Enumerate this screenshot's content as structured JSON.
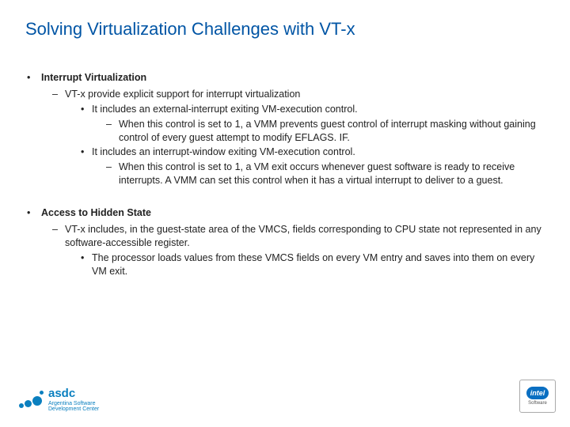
{
  "title": "Solving Virtualization Challenges with VT-x",
  "section1": {
    "heading": "Interrupt Virtualization",
    "l2": "VT-x provide explicit support for interrupt virtualization",
    "l3a": "It includes an external-interrupt exiting VM-execution control.",
    "l4a": "When this control is set to 1, a VMM prevents guest control of interrupt masking without gaining control of every guest attempt to modify EFLAGS. IF.",
    "l3b": "It includes an interrupt-window exiting VM-execution control.",
    "l4b": "When this control is set to 1, a VM exit occurs whenever guest software is ready to receive interrupts. A VMM can set this control when it has a virtual interrupt to deliver to a guest."
  },
  "section2": {
    "heading": "Access to Hidden State",
    "l2": "VT-x includes, in the guest-state area of the VMCS, fields corresponding to CPU state not represented in any software-accessible register.",
    "l3": "The processor loads values from these VMCS fields on every VM entry and saves into them on every VM exit."
  },
  "footer": {
    "asdc_name": "asdc",
    "asdc_sub1": "Argentina Software",
    "asdc_sub2": "Development Center",
    "intel": "intel",
    "intel_sub": "Software"
  }
}
